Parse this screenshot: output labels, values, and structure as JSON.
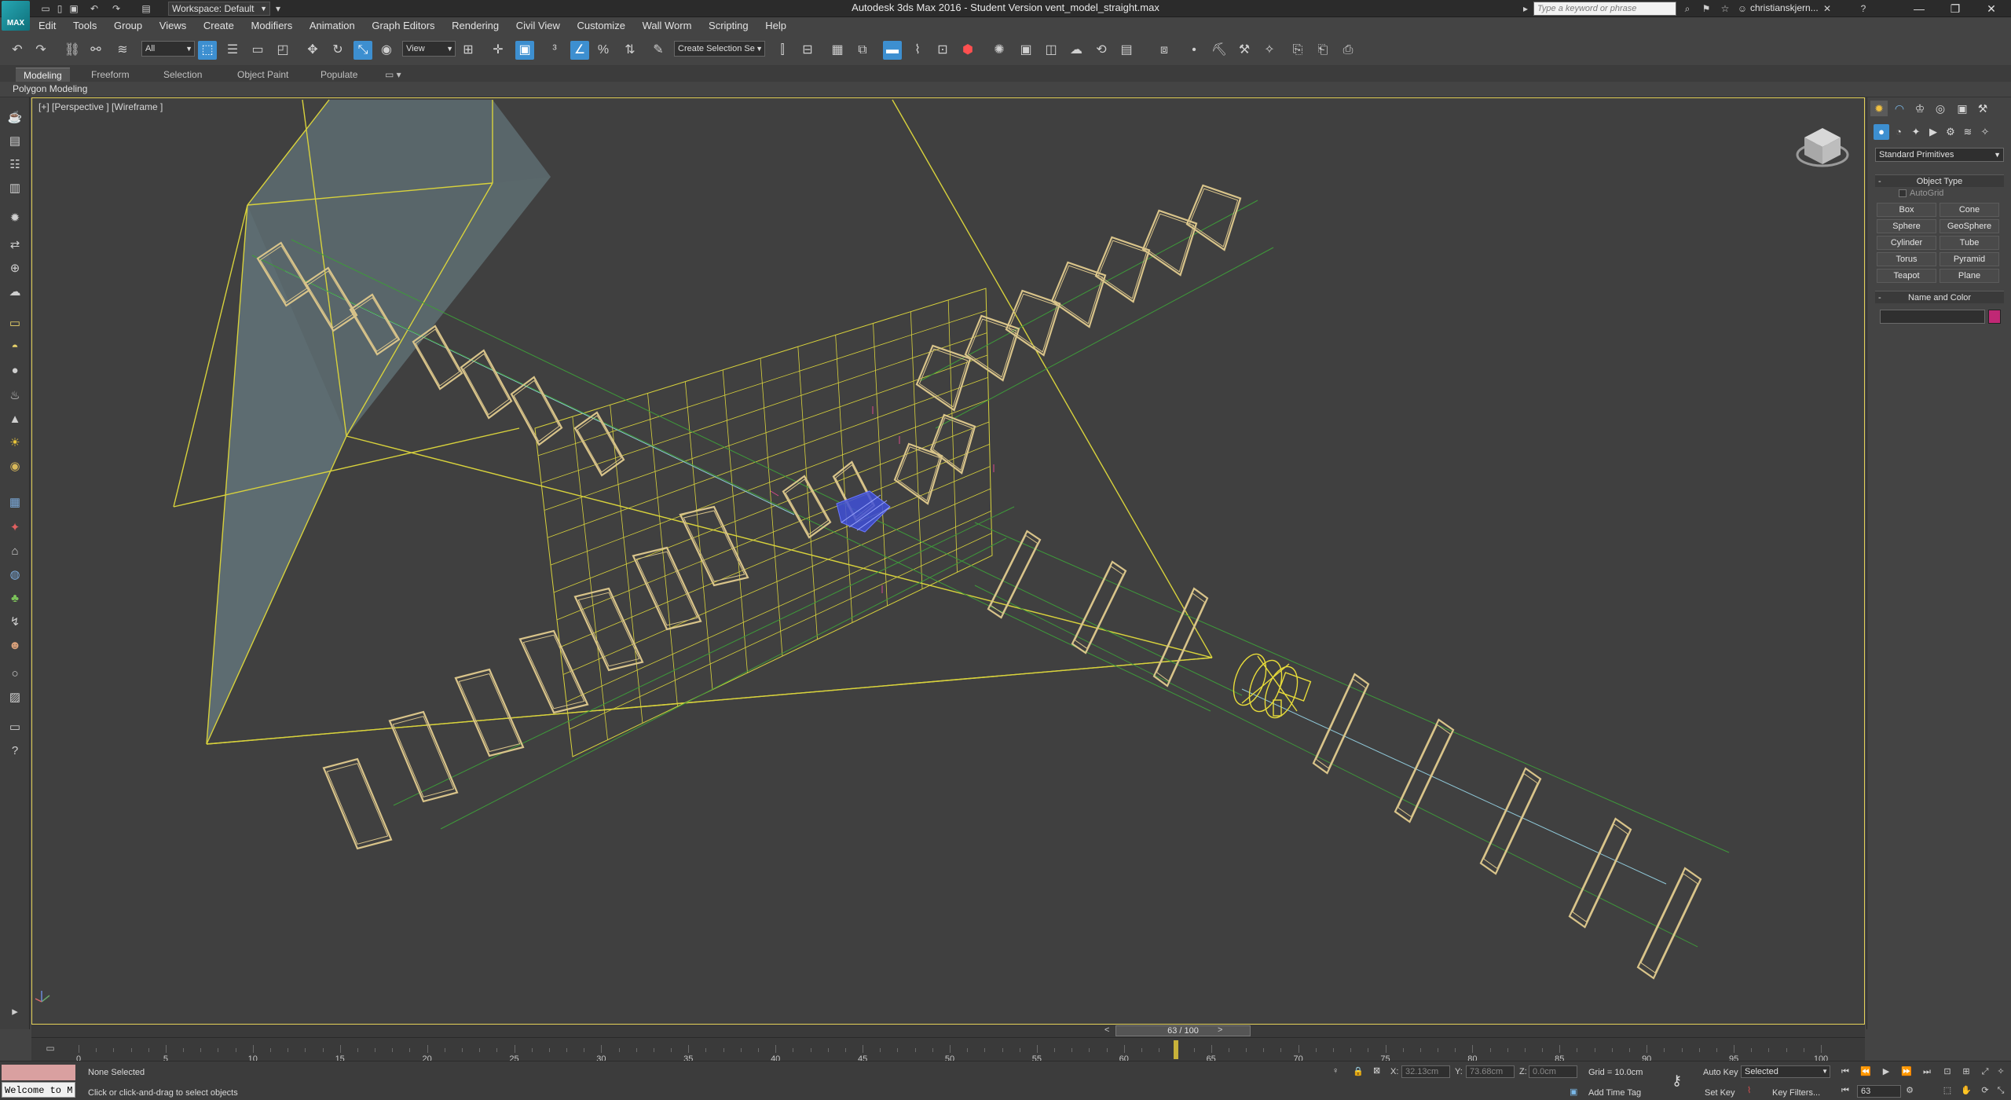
{
  "window": {
    "title": "Autodesk 3ds Max 2016 - Student Version    vent_model_straight.max",
    "app_logo": "MAX",
    "workspace": "Workspace: Default",
    "search_placeholder": "Type a keyword or phrase",
    "user": "christianskjern..."
  },
  "menu": [
    "Edit",
    "Tools",
    "Group",
    "Views",
    "Create",
    "Modifiers",
    "Animation",
    "Graph Editors",
    "Rendering",
    "Civil View",
    "Customize",
    "Wall Worm",
    "Scripting",
    "Help"
  ],
  "toolbar": {
    "selection_filter": "All",
    "reference_coord": "View",
    "named_selection": "Create Selection Se"
  },
  "ribbon": {
    "tabs": [
      "Modeling",
      "Freeform",
      "Selection",
      "Object Paint",
      "Populate"
    ],
    "active_tab": "Modeling",
    "sub_label": "Polygon Modeling"
  },
  "viewport": {
    "label": "[+] [Perspective ] [Wireframe ]",
    "border_color": "#e6d35a"
  },
  "command_panel": {
    "category": "Standard Primitives",
    "object_type_title": "Object Type",
    "autogrid": "AutoGrid",
    "buttons": [
      "Box",
      "Cone",
      "Sphere",
      "GeoSphere",
      "Cylinder",
      "Tube",
      "Torus",
      "Pyramid",
      "Teapot",
      "Plane"
    ],
    "name_color_title": "Name and Color",
    "object_color": "#c02875"
  },
  "timeline": {
    "frame_display": "63 / 100",
    "prev": "<",
    "next": ">",
    "ticks": [
      "0",
      "5",
      "10",
      "15",
      "20",
      "25",
      "30",
      "35",
      "40",
      "45",
      "50",
      "55",
      "60",
      "65",
      "70",
      "75",
      "80",
      "85",
      "90",
      "95",
      "100"
    ],
    "current_frame": 63,
    "total_frames": 100
  },
  "status": {
    "selection": "None Selected",
    "prompt": "Click or click-and-drag to select objects",
    "welcome": "Welcome to M",
    "x_label": "X:",
    "x_value": "32.13cm",
    "y_label": "Y:",
    "y_value": "73.68cm",
    "z_label": "Z:",
    "z_value": "0.0cm",
    "grid": "Grid = 10.0cm",
    "add_time_tag": "Add Time Tag",
    "auto_key": "Auto Key",
    "auto_key_mode": "Selected",
    "set_key": "Set Key",
    "key_filters": "Key Filters...",
    "frame_field": "63"
  }
}
